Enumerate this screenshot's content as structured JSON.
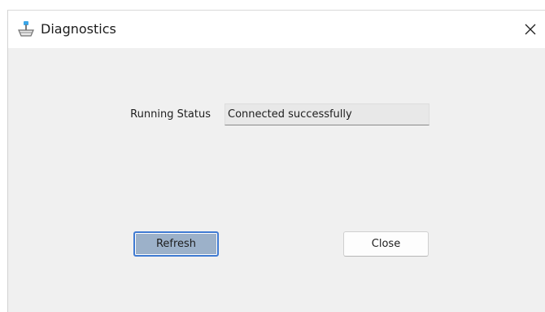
{
  "window": {
    "title": "Diagnostics",
    "app_icon": "diagnostics-app-icon",
    "close_glyph": "✕"
  },
  "status": {
    "label": "Running Status",
    "value": "Connected successfully"
  },
  "buttons": {
    "refresh": "Refresh",
    "close": "Close"
  },
  "colors": {
    "accent": "#3f7ad2",
    "refresh_fill": "#9cb1c9",
    "dialog_background": "#f0f0f0"
  }
}
